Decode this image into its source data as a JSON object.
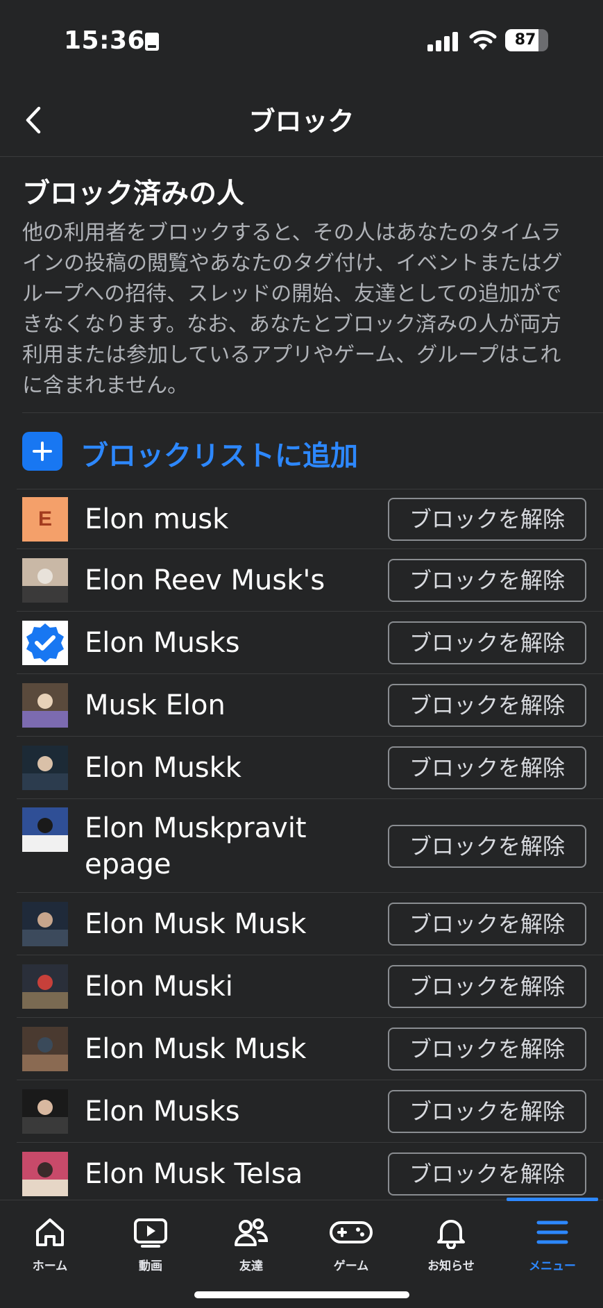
{
  "status_bar": {
    "time": "15:36",
    "battery": "87"
  },
  "header": {
    "title": "ブロック"
  },
  "section": {
    "title": "ブロック済みの人",
    "description": "他の利用者をブロックすると、その人はあなたのタイムラインの投稿の閲覧やあなたのタグ付け、イベントまたはグループへの招待、スレッドの開始、友達としての追加ができなくなります。なお、あなたとブロック済みの人が両方利用または参加しているアプリやゲーム、グループはこれに含まれません。"
  },
  "add_to_block_list": {
    "label": "ブロックリストに追加"
  },
  "blocked_people": [
    {
      "name": "Elon musk",
      "unblock_label": "ブロックを解除",
      "avatar": "letter-e"
    },
    {
      "name": "Elon Reev Musk's",
      "unblock_label": "ブロックを解除",
      "avatar": "photo"
    },
    {
      "name": "Elon Musks",
      "unblock_label": "ブロックを解除",
      "avatar": "verified-badge"
    },
    {
      "name": "Musk Elon",
      "unblock_label": "ブロックを解除",
      "avatar": "photo"
    },
    {
      "name": "Elon Muskk",
      "unblock_label": "ブロックを解除",
      "avatar": "photo"
    },
    {
      "name": "Elon Muskpravitepage",
      "unblock_label": "ブロックを解除",
      "avatar": "photo"
    },
    {
      "name": "Elon Musk Musk",
      "unblock_label": "ブロックを解除",
      "avatar": "photo"
    },
    {
      "name": "Elon Muski",
      "unblock_label": "ブロックを解除",
      "avatar": "photo"
    },
    {
      "name": "Elon Musk Musk",
      "unblock_label": "ブロックを解除",
      "avatar": "photo"
    },
    {
      "name": "Elon Musks",
      "unblock_label": "ブロックを解除",
      "avatar": "photo"
    },
    {
      "name": "Elon Musk Telsa",
      "unblock_label": "ブロックを解除",
      "avatar": "photo"
    }
  ],
  "avatar_letter": "E",
  "bottom_nav": {
    "items": [
      {
        "label": "ホーム",
        "icon": "home-icon"
      },
      {
        "label": "動画",
        "icon": "video-icon"
      },
      {
        "label": "友達",
        "icon": "friends-icon"
      },
      {
        "label": "ゲーム",
        "icon": "gaming-icon"
      },
      {
        "label": "お知らせ",
        "icon": "bell-icon"
      },
      {
        "label": "メニュー",
        "icon": "menu-icon",
        "active": true
      }
    ]
  },
  "colors": {
    "background": "#242526",
    "accent": "#2d88ff",
    "button_border": "#8a8d91"
  }
}
